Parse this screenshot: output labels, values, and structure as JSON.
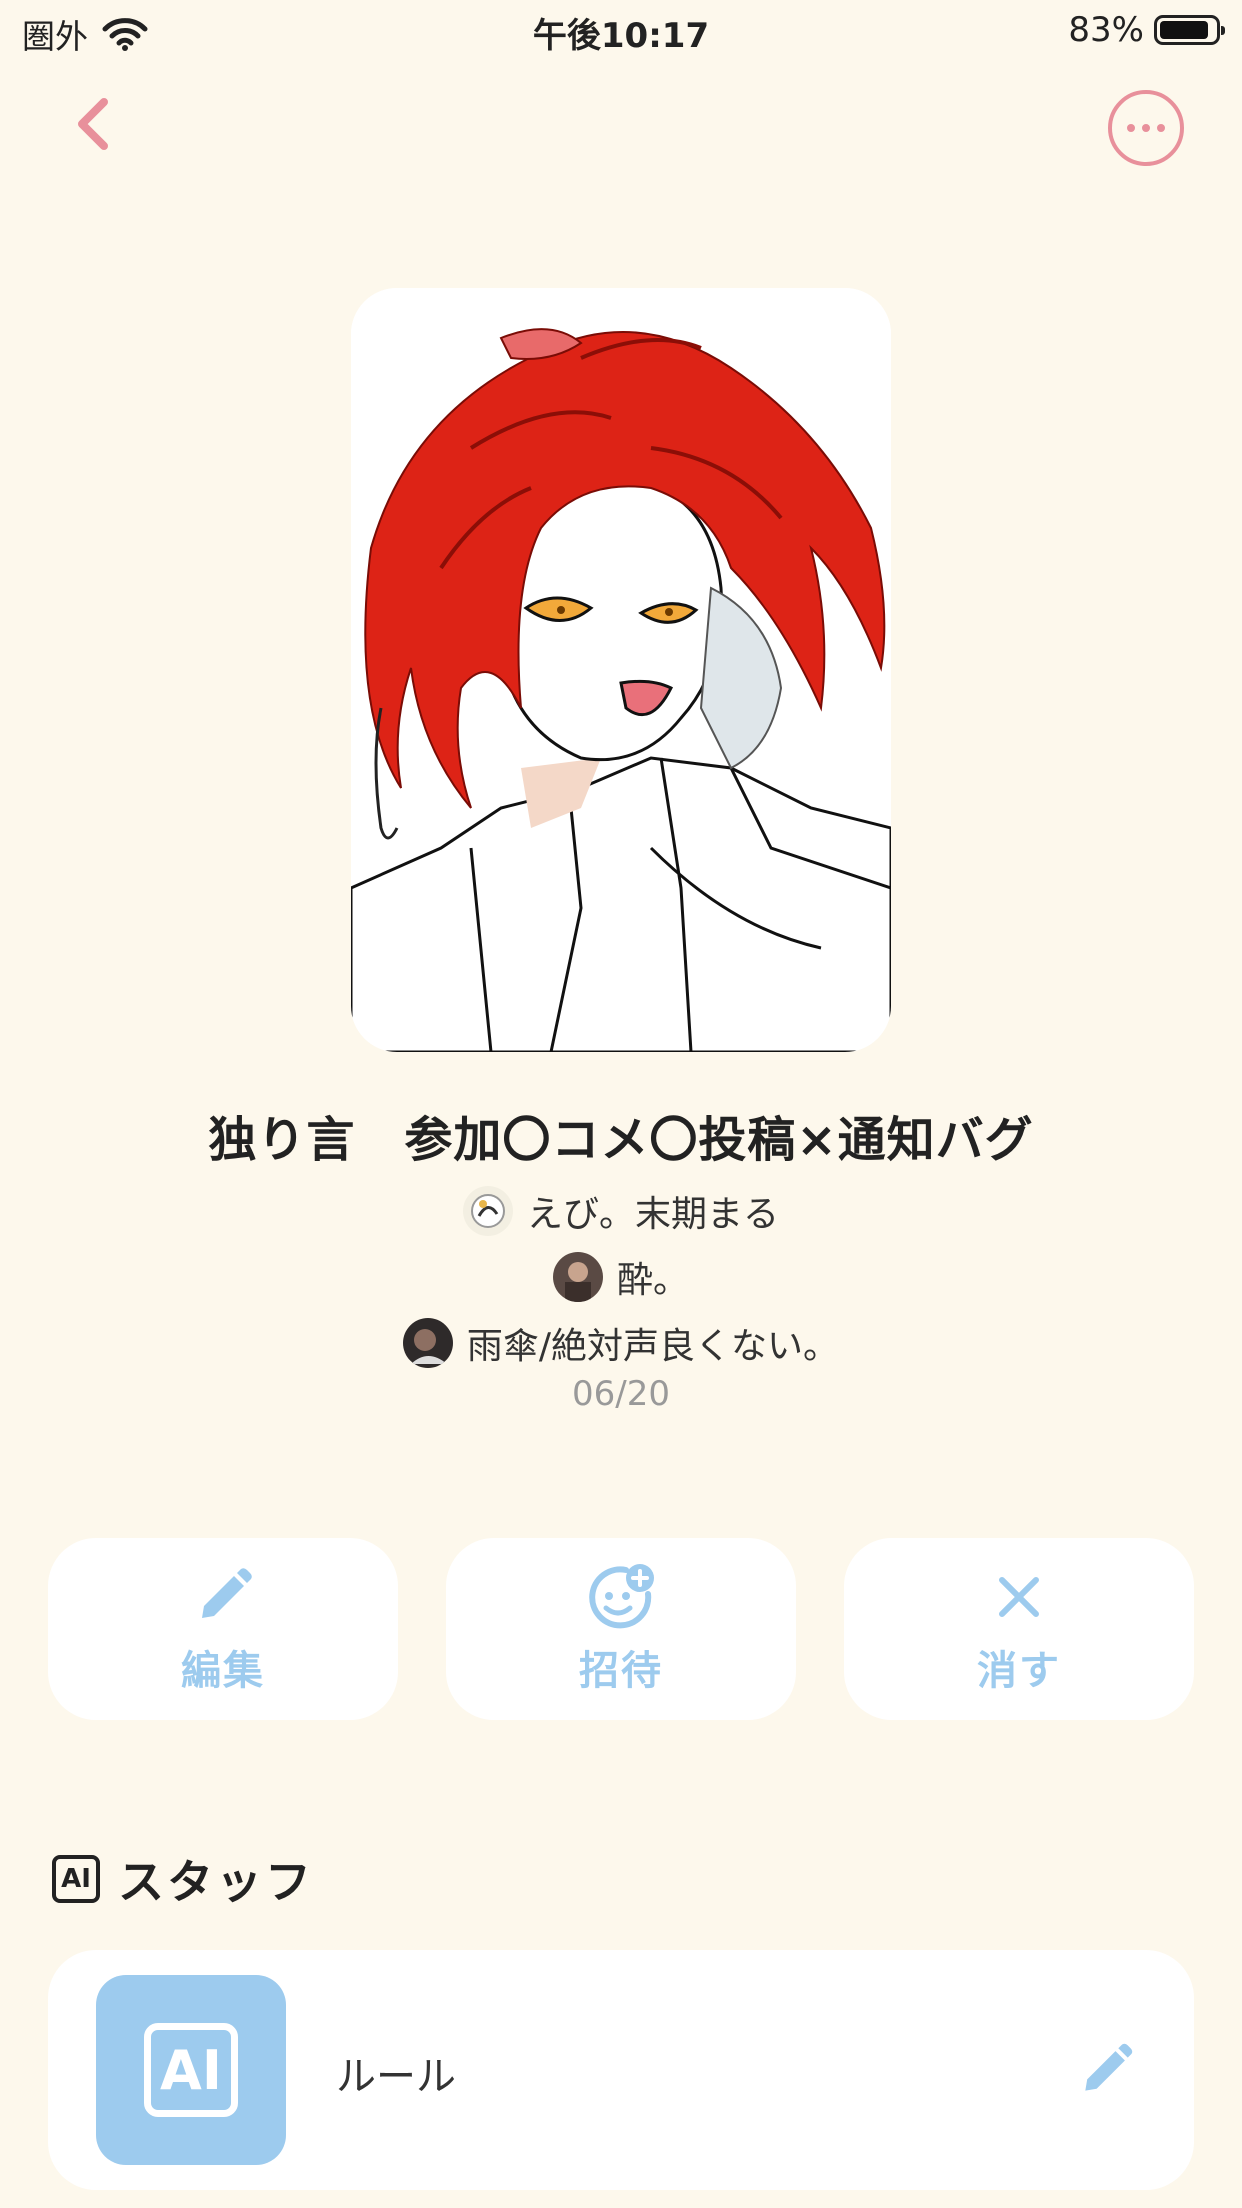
{
  "status_bar": {
    "carrier": "圏外",
    "time": "午後10:17",
    "battery": "83%",
    "battery_level": 0.83
  },
  "nav": {
    "back_icon": "chevron-left-icon",
    "more_icon": "more-horizontal-circle-icon",
    "accent_color": "#e8909b"
  },
  "room": {
    "title": "独り言　参加〇コメ〇投稿×通知バグ",
    "members": [
      {
        "name": "えび。末期まる"
      },
      {
        "name": "酔。"
      },
      {
        "name": "雨傘/絶対声良くない。"
      }
    ],
    "date": "06/20"
  },
  "actions": [
    {
      "label": "編集",
      "icon": "pencil-icon"
    },
    {
      "label": "招待",
      "icon": "add-friend-icon"
    },
    {
      "label": "消す",
      "icon": "close-icon"
    }
  ],
  "action_color": "#9dcbee",
  "staff": {
    "badge": "AI",
    "title": "スタッフ",
    "items": [
      {
        "label": "ルール",
        "badge": "AI",
        "edit_icon": "pencil-icon"
      }
    ]
  }
}
